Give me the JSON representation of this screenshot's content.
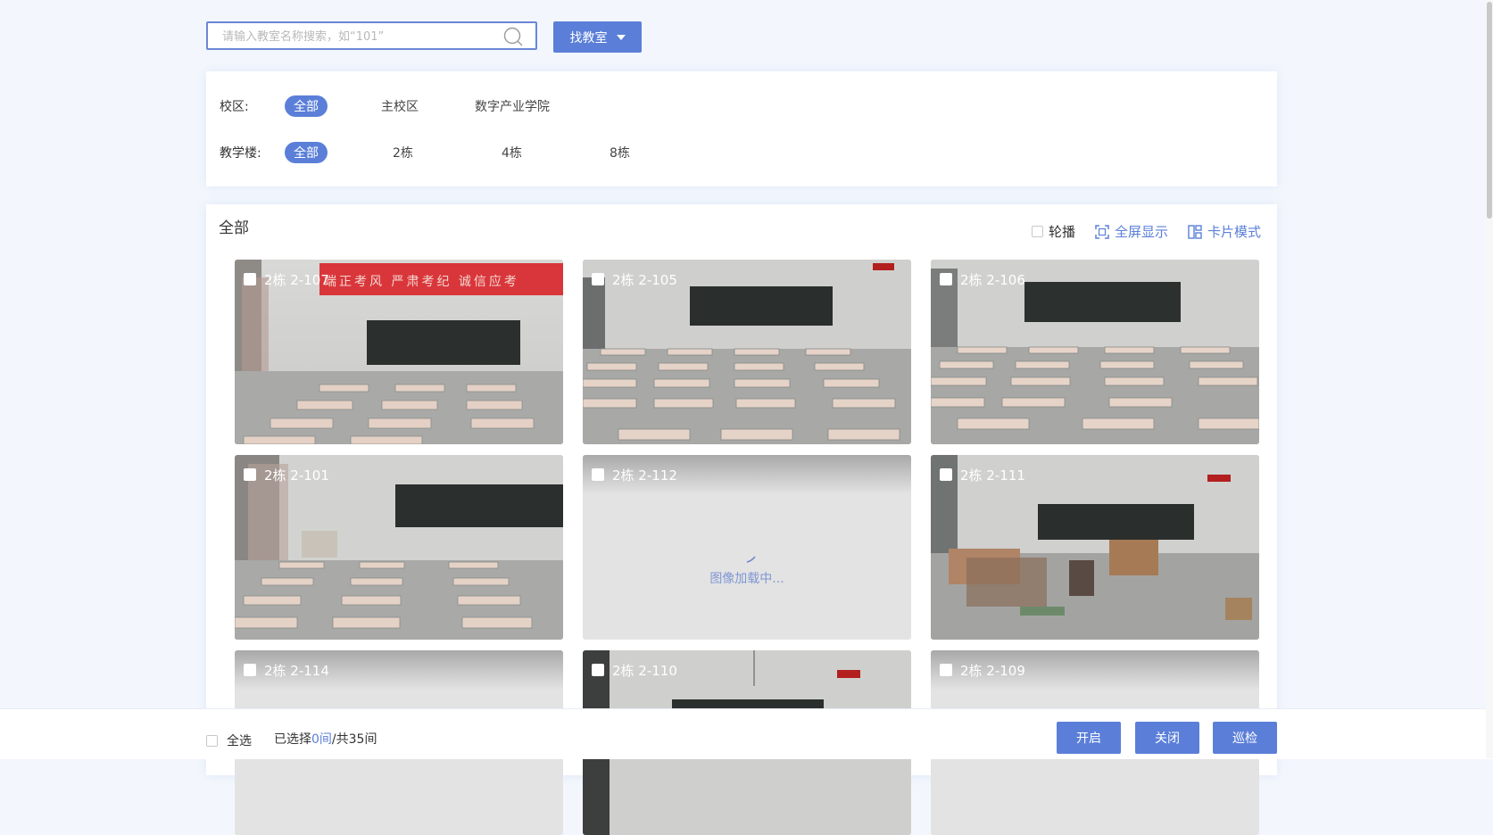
{
  "search": {
    "placeholder": "请输入教室名称搜索，如“101”",
    "value": "",
    "icon": "search-icon",
    "find_button": "找教室"
  },
  "filters": {
    "campus": {
      "label": "校区:",
      "options": [
        "全部",
        "主校区",
        "数字产业学院"
      ],
      "selected": "全部"
    },
    "building": {
      "label": "教学楼:",
      "options": [
        "全部",
        "2栋",
        "4栋",
        "8栋"
      ],
      "selected": "全部"
    }
  },
  "main": {
    "title": "全部",
    "tools": {
      "carousel": "轮播",
      "fullscreen": "全屏显示",
      "card_mode": "卡片模式"
    },
    "cards": [
      {
        "name": "2栋 2-107",
        "status": "live",
        "banner": "端正考风  严肃考纪  诚信应考"
      },
      {
        "name": "2栋 2-105",
        "status": "live"
      },
      {
        "name": "2栋 2-106",
        "status": "live"
      },
      {
        "name": "2栋 2-101",
        "status": "live"
      },
      {
        "name": "2栋 2-112",
        "status": "loading",
        "loading_text": "图像加载中..."
      },
      {
        "name": "2栋 2-111",
        "status": "live"
      },
      {
        "name": "2栋 2-114",
        "status": "loading"
      },
      {
        "name": "2栋 2-110",
        "status": "live"
      },
      {
        "name": "2栋 2-109",
        "status": "loading"
      }
    ]
  },
  "bottom": {
    "select_all": "全选",
    "selected_prefix": "已选择",
    "selected_count": "0间",
    "total": "/共35间",
    "buttons": {
      "open": "开启",
      "close": "关闭",
      "patrol": "巡检"
    }
  },
  "colors": {
    "accent": "#5b7fd8",
    "page_bg": "#f3f7fd",
    "loading_bg": "#e3e3e3"
  }
}
